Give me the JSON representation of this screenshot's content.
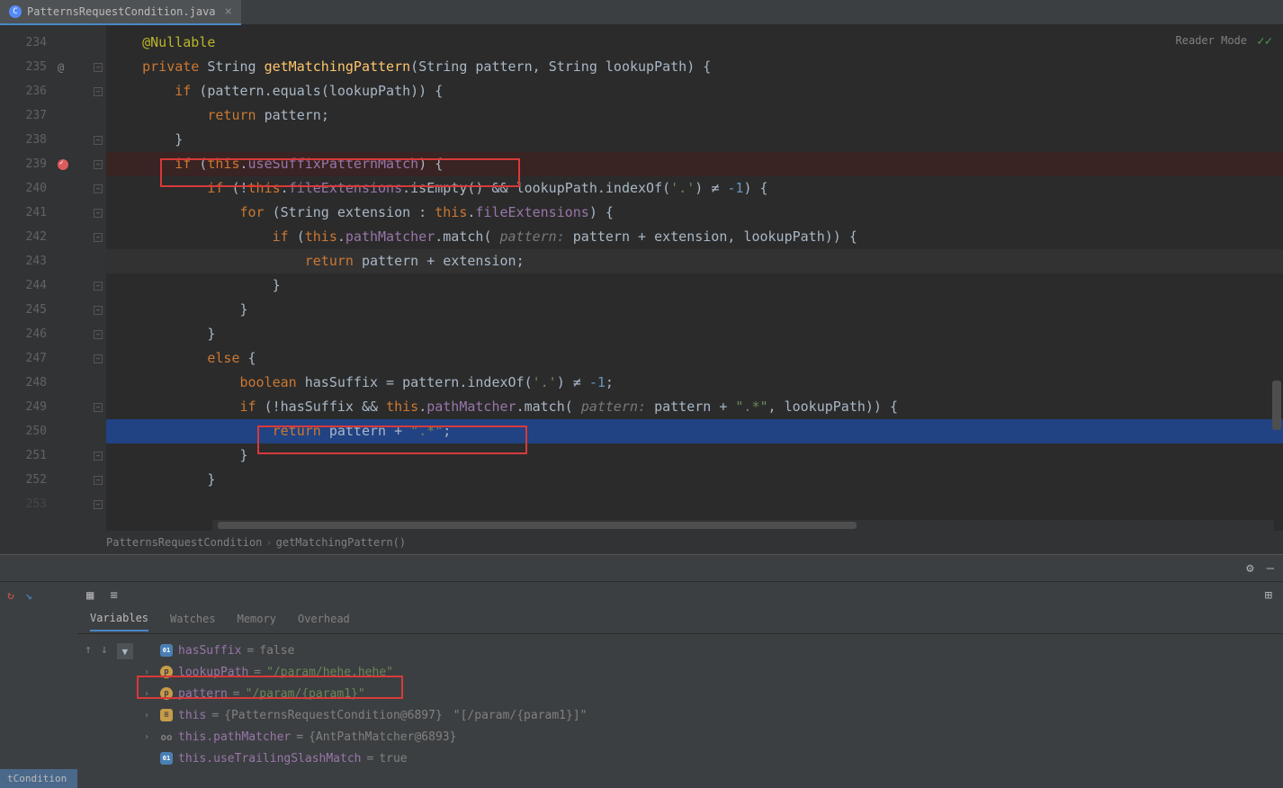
{
  "tab": {
    "filename": "PatternsRequestCondition.java"
  },
  "reader_mode": "Reader Mode",
  "breadcrumb": {
    "class": "PatternsRequestCondition",
    "method": "getMatchingPattern()"
  },
  "lines": {
    "l234": "234",
    "l235": "235",
    "l236": "236",
    "l237": "237",
    "l238": "238",
    "l239": "239",
    "l240": "240",
    "l241": "241",
    "l242": "242",
    "l243": "243",
    "l244": "244",
    "l245": "245",
    "l246": "246",
    "l247": "247",
    "l248": "248",
    "l249": "249",
    "l250": "250",
    "l251": "251",
    "l252": "252",
    "l253": "253"
  },
  "code": {
    "annotation": "@Nullable",
    "kw_private": "private",
    "kw_if": "if",
    "kw_return": "return",
    "kw_for": "for",
    "kw_this": "this",
    "kw_else": "else",
    "kw_boolean": "boolean",
    "type_string": "String",
    "method_name": "getMatchingPattern",
    "param_pattern": "pattern",
    "param_lookup": "lookupPath",
    "m_equals": "equals",
    "m_isEmpty": "isEmpty",
    "m_indexOf": "indexOf",
    "m_match": "match",
    "f_useSuffix": "useSuffixPatternMatch",
    "f_fileExt": "fileExtensions",
    "f_pathMatcher": "pathMatcher",
    "var_extension": "extension",
    "var_hasSuffix": "hasSuffix",
    "hint_pattern": "pattern:",
    "str_dot": "'.'",
    "str_dotstar": "\".*\"",
    "num_neg1": "-1",
    "neq": "≠"
  },
  "debug": {
    "tabs": {
      "variables": "Variables",
      "watches": "Watches",
      "memory": "Memory",
      "overhead": "Overhead"
    },
    "left_tab": "tCondition",
    "vars": {
      "hasSuffix": {
        "name": "hasSuffix",
        "val": "false"
      },
      "lookupPath": {
        "name": "lookupPath",
        "val": "\"/param/hehe.hehe\""
      },
      "pattern": {
        "name": "pattern",
        "val": "\"/param/{param1}\""
      },
      "this": {
        "name": "this",
        "ref": "{PatternsRequestCondition@6897}",
        "val": "\"[/param/{param1}]\""
      },
      "pathMatcher": {
        "name": "this.pathMatcher",
        "ref": "{AntPathMatcher@6893}"
      },
      "trailing": {
        "name": "this.useTrailingSlashMatch",
        "val": "true"
      }
    }
  }
}
